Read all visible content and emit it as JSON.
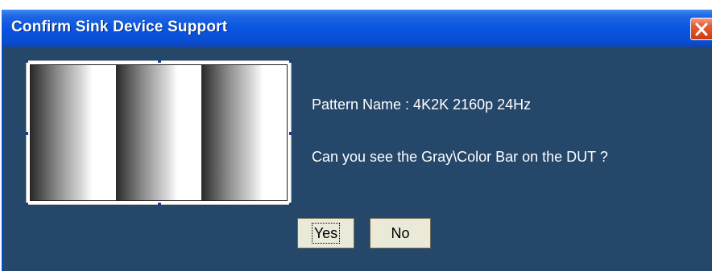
{
  "window": {
    "title": "Confirm Sink Device Support",
    "close_icon": "close-icon"
  },
  "dialog": {
    "pattern_name_text": "Pattern Name : 4K2K 2160p 24Hz",
    "question_text": "Can you see the Gray\\Color Bar on the DUT ?",
    "pattern_preview": "gray-bar-pattern"
  },
  "buttons": {
    "yes_label": "Yes",
    "no_label": "No"
  },
  "colors": {
    "titlebar": "#0a55df",
    "body": "#25476a",
    "close": "#cf3a12",
    "button_face": "#ebe9d8"
  }
}
